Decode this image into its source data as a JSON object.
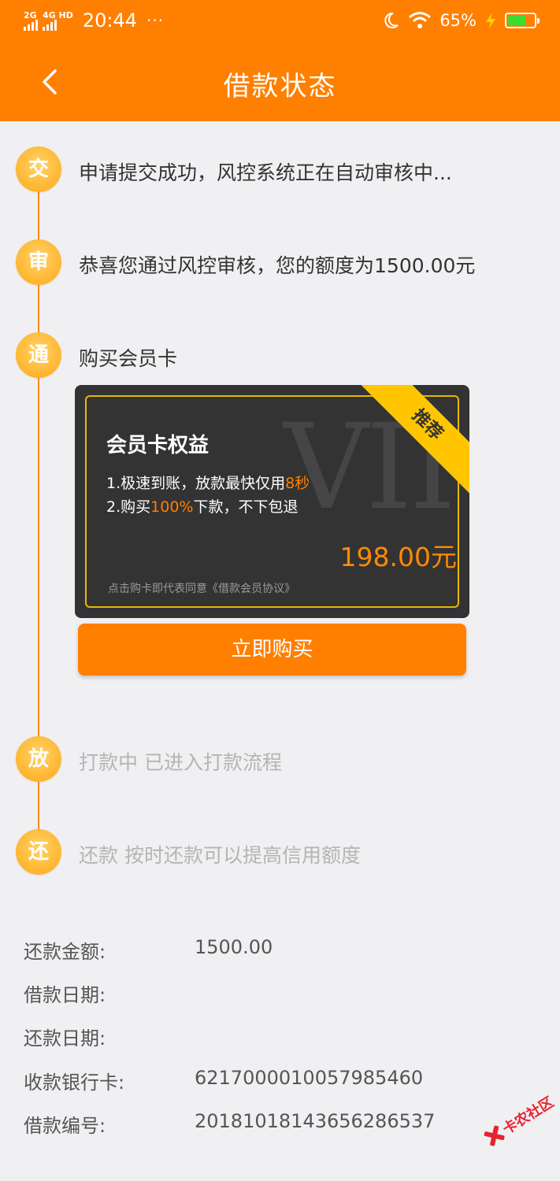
{
  "status_bar": {
    "sim1_label": "2G",
    "sim2_label": "4G HD",
    "time": "20:44",
    "dots": "···",
    "battery_percent": "65%",
    "icons": [
      "signal-icon",
      "moon-icon",
      "wifi-icon",
      "charging-icon",
      "battery-icon"
    ]
  },
  "header": {
    "title": "借款状态"
  },
  "timeline": {
    "steps": [
      {
        "icon_char": "交",
        "text": "申请提交成功，风控系统正在自动审核中...",
        "active": true
      },
      {
        "icon_char": "审",
        "text": "恭喜您通过风控审核，您的额度为1500.00元",
        "active": true
      },
      {
        "icon_char": "通",
        "text": "购买会员卡",
        "active": true
      },
      {
        "icon_char": "放",
        "text": "打款中 已进入打款流程",
        "active": false
      },
      {
        "icon_char": "还",
        "text": "还款 按时还款可以提高信用额度",
        "active": false
      }
    ]
  },
  "vip_card": {
    "watermark": "VII",
    "ribbon": "推荐",
    "title": "会员卡权益",
    "benefit1_pre": "1.极速到账，放款最快仅用",
    "benefit1_hl": "8秒",
    "benefit2_pre": "2.购买",
    "benefit2_hl": "100%",
    "benefit2_post": "下款，不下包退",
    "price": "198.00元",
    "agreement": "点击购卡即代表同意《借款会员协议》",
    "buy_button": "立即购买"
  },
  "info": {
    "rows": [
      {
        "label": "还款金额:",
        "value": "1500.00"
      },
      {
        "label": "借款日期:",
        "value": ""
      },
      {
        "label": "还款日期:",
        "value": ""
      },
      {
        "label": "收款银行卡:",
        "value": "6217000010057985460"
      },
      {
        "label": "借款编号:",
        "value": "20181018143656286537"
      }
    ]
  },
  "watermark_logo": "卡农社区",
  "colors": {
    "primary": "#ff7f00",
    "circle": "#ffb52e",
    "card_bg": "#333333",
    "card_border": "#e8b800",
    "ribbon": "#ffc600",
    "background": "#f0eff2"
  }
}
